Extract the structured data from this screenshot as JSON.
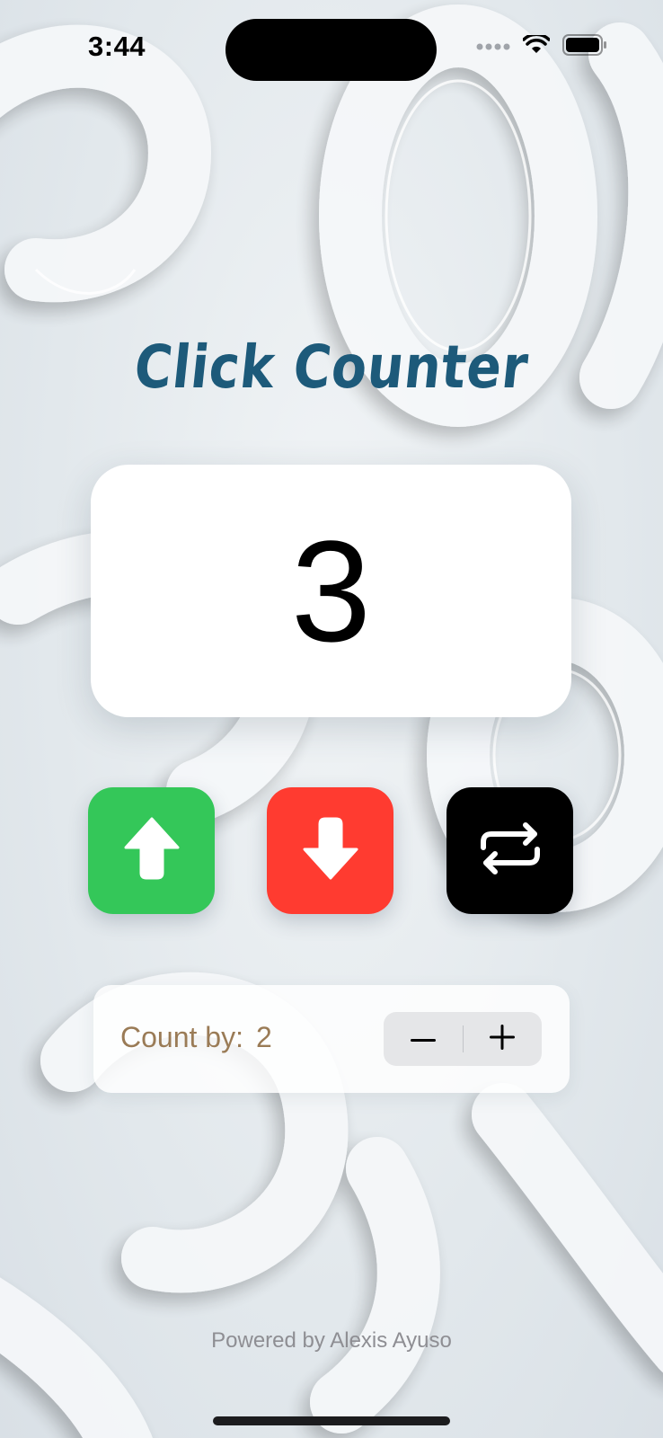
{
  "status_bar": {
    "time": "3:44"
  },
  "title": "Click Counter",
  "counter": {
    "value": "3"
  },
  "buttons": {
    "increment_icon": "arrow-up-icon",
    "decrement_icon": "arrow-down-icon",
    "reset_icon": "repeat-icon",
    "increment_color": "#34c759",
    "decrement_color": "#ff3b30",
    "reset_color": "#000000"
  },
  "count_by": {
    "label": "Count by:",
    "value": "2",
    "decrease_icon": "minus-icon",
    "increase_icon": "plus-icon"
  },
  "footer": "Powered by Alexis Ayuso",
  "colors": {
    "title": "#1d5a7a",
    "count_by_text": "#9a7b56"
  }
}
